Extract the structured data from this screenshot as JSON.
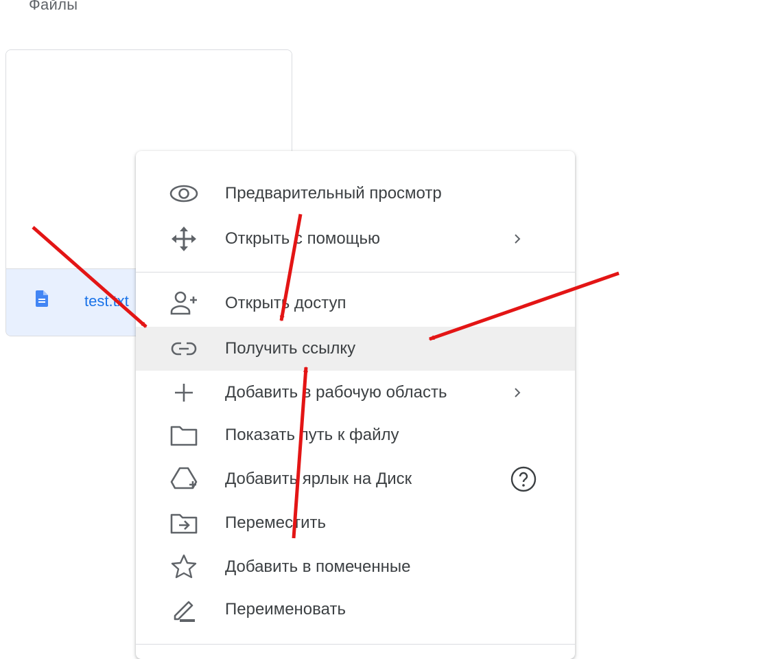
{
  "page": {
    "section_title": "Файлы"
  },
  "file_card": {
    "name": "test.txt",
    "icon": "doc-icon"
  },
  "menu": {
    "items": [
      {
        "label": "Предварительный просмотр",
        "icon": "eye-icon"
      },
      {
        "label": "Открыть с помощью",
        "icon": "open-with-icon",
        "submenu": true
      },
      {
        "label": "Открыть доступ",
        "icon": "person-add-icon"
      },
      {
        "label": "Получить ссылку",
        "icon": "link-icon",
        "hovered": true
      },
      {
        "label": "Добавить в рабочую область",
        "icon": "plus-icon",
        "submenu": true
      },
      {
        "label": "Показать путь к файлу",
        "icon": "folder-icon"
      },
      {
        "label": "Добавить ярлык на Диск",
        "icon": "drive-shortcut-icon",
        "help": true
      },
      {
        "label": "Переместить",
        "icon": "move-to-folder-icon"
      },
      {
        "label": "Добавить в помеченные",
        "icon": "star-icon"
      },
      {
        "label": "Переименовать",
        "icon": "rename-icon"
      }
    ]
  },
  "colors": {
    "accent": "#1a73e8",
    "hover": "#efefef",
    "annotation": "#e31515",
    "card_footer": "#e8f0fe"
  }
}
